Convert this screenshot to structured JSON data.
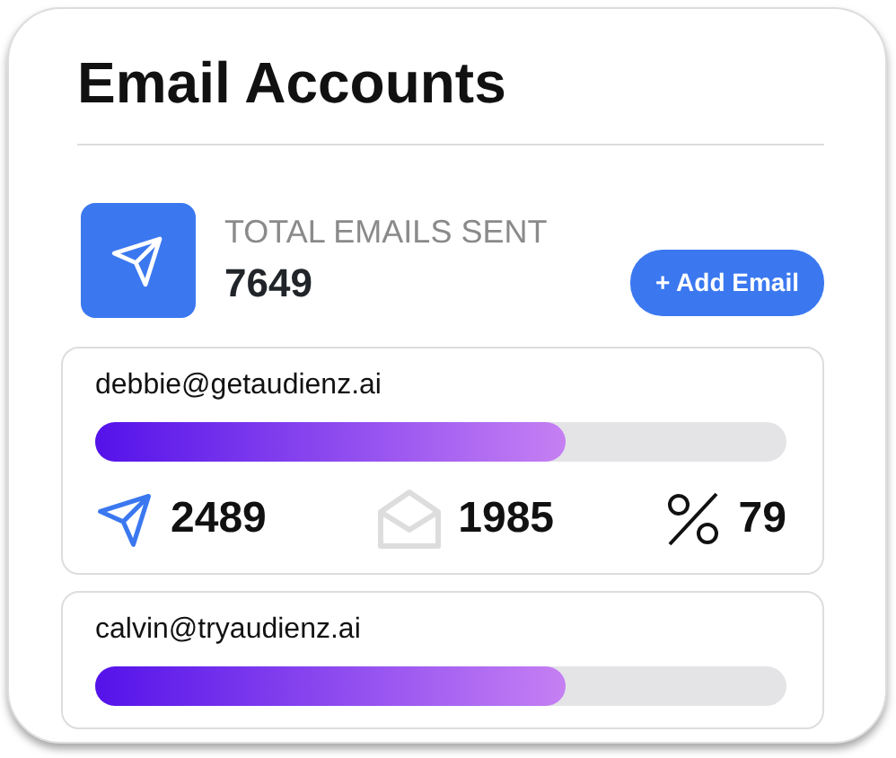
{
  "title": "Email Accounts",
  "summary": {
    "label": "TOTAL EMAILS SENT",
    "value": "7649",
    "button": "+ Add Email"
  },
  "accounts": [
    {
      "email": "debbie@getaudienz.ai",
      "level": 0.68,
      "stats": {
        "sent": "2489",
        "opened": "1985",
        "rate": "79"
      }
    },
    {
      "email": "calvin@tryaudienz.ai",
      "level": 0.68
    }
  ]
}
